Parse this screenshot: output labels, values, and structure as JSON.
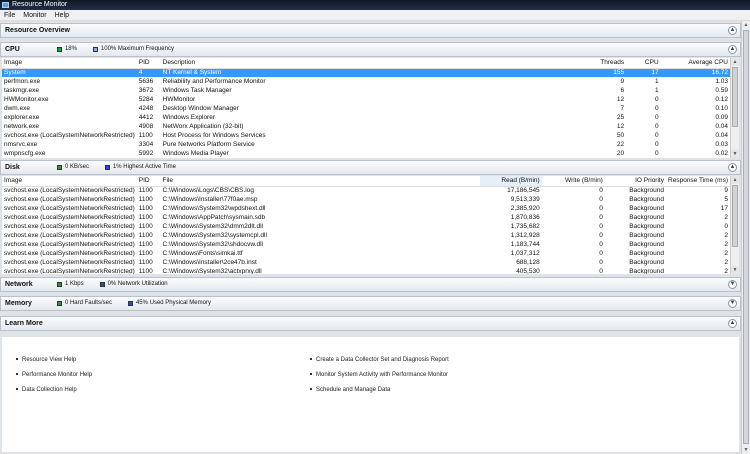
{
  "window": {
    "title": "Resource Monitor"
  },
  "menu": [
    "File",
    "Monitor",
    "Help"
  ],
  "overview": {
    "title": "Resource Overview"
  },
  "cpu": {
    "title": "CPU",
    "stat1": "18%",
    "stat2": "100% Maximum Frequency",
    "columns": [
      "Image",
      "PID",
      "Description",
      "Threads",
      "CPU",
      "Average CPU"
    ],
    "rows": [
      [
        "System",
        "4",
        "NT Kernel & System",
        "155",
        "17",
        "16.72"
      ],
      [
        "perfmon.exe",
        "5636",
        "Reliability and Performance Monitor",
        "9",
        "1",
        "1.03"
      ],
      [
        "taskmgr.exe",
        "3672",
        "Windows Task Manager",
        "6",
        "1",
        "0.59"
      ],
      [
        "HWMonitor.exe",
        "5284",
        "HWMonitor",
        "12",
        "0",
        "0.12"
      ],
      [
        "dwm.exe",
        "4248",
        "Desktop Window Manager",
        "7",
        "0",
        "0.10"
      ],
      [
        "explorer.exe",
        "4412",
        "Windows Explorer",
        "25",
        "0",
        "0.09"
      ],
      [
        "network.exe",
        "4908",
        "NetWorx Application (32-bit)",
        "12",
        "0",
        "0.04"
      ],
      [
        "svchost.exe (LocalSystemNetworkRestricted)",
        "1100",
        "Host Process for Windows Services",
        "50",
        "0",
        "0.04"
      ],
      [
        "nmsrvc.exe",
        "3304",
        "Pure Networks Platform Service",
        "22",
        "0",
        "0.03"
      ],
      [
        "wmpnscfg.exe",
        "5992",
        "Windows Media Player",
        "20",
        "0",
        "0.02"
      ]
    ]
  },
  "disk": {
    "title": "Disk",
    "stat1": "0 KB/sec",
    "stat2": "1% Highest Active Time",
    "columns": [
      "Image",
      "PID",
      "File",
      "Read (B/min)",
      "Write (B/min)",
      "IO Priority",
      "Response Time (ms)"
    ],
    "rows": [
      [
        "svchost.exe (LocalSystemNetworkRestricted)",
        "1100",
        "C:\\Windows\\Logs\\CBS\\CBS.log",
        "17,186,545",
        "0",
        "Background",
        "9"
      ],
      [
        "svchost.exe (LocalSystemNetworkRestricted)",
        "1100",
        "C:\\Windows\\Installer\\77f0ae.msp",
        "9,513,339",
        "0",
        "Background",
        "5"
      ],
      [
        "svchost.exe (LocalSystemNetworkRestricted)",
        "1100",
        "C:\\Windows\\System32\\wpdshext.dll",
        "2,385,920",
        "0",
        "Background",
        "17"
      ],
      [
        "svchost.exe (LocalSystemNetworkRestricted)",
        "1100",
        "C:\\Windows\\AppPatch\\sysmain.sdb",
        "1,870,836",
        "0",
        "Background",
        "2"
      ],
      [
        "svchost.exe (LocalSystemNetworkRestricted)",
        "1100",
        "C:\\Windows\\System32\\dmm2dlt.dll",
        "1,735,682",
        "0",
        "Background",
        "0"
      ],
      [
        "svchost.exe (LocalSystemNetworkRestricted)",
        "1100",
        "C:\\Windows\\System32\\systemcpl.dll",
        "1,312,928",
        "0",
        "Background",
        "2"
      ],
      [
        "svchost.exe (LocalSystemNetworkRestricted)",
        "1100",
        "C:\\Windows\\System32\\shdocvw.dll",
        "1,183,744",
        "0",
        "Background",
        "2"
      ],
      [
        "svchost.exe (LocalSystemNetworkRestricted)",
        "1100",
        "C:\\Windows\\Fonts\\simkai.ttf",
        "1,037,312",
        "0",
        "Background",
        "2"
      ],
      [
        "svchost.exe (LocalSystemNetworkRestricted)",
        "1100",
        "C:\\Windows\\Installer\\2ce47b.inst",
        "688,128",
        "0",
        "Background",
        "2"
      ],
      [
        "svchost.exe (LocalSystemNetworkRestricted)",
        "1100",
        "C:\\Windows\\System32\\actxprxy.dll",
        "405,530",
        "0",
        "Background",
        "2"
      ]
    ]
  },
  "network": {
    "title": "Network",
    "stat1": "1 Kbps",
    "stat2": "0% Network Utilization"
  },
  "memory": {
    "title": "Memory",
    "stat1": "0 Hard Faults/sec",
    "stat2": "45% Used Physical Memory"
  },
  "learn": {
    "title": "Learn More",
    "links": [
      "Resource View Help",
      "Performance Monitor Help",
      "Data Collection Help",
      "Create a Data Collector Set and Diagnosis Report",
      "Monitor System Activity with Performance Monitor",
      "Schedule and Manage Data"
    ]
  },
  "colors": {
    "cpu": "#1fa12f",
    "maxfreq": "#7fb2e8",
    "active": "#1e4cd8",
    "selection": "#3399ff"
  }
}
